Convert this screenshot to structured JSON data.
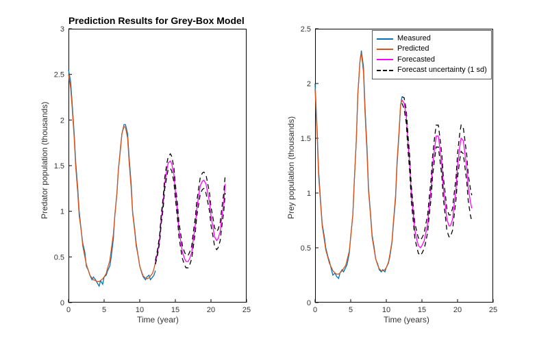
{
  "title": "Prediction Results for Grey-Box Model",
  "legend": {
    "items": [
      {
        "label": "Measured",
        "color": "#0072BD",
        "dash": "solid"
      },
      {
        "label": "Predicted",
        "color": "#D95319",
        "dash": "solid"
      },
      {
        "label": "Forecasted",
        "color": "#FF00FF",
        "dash": "solid"
      },
      {
        "label": "Forecast uncertainty (1 sd)",
        "color": "#000000",
        "dash": "dashed"
      }
    ]
  },
  "chart_data": [
    {
      "type": "line",
      "title": "",
      "xlabel": "Time (year)",
      "ylabel": "Predator population (thousands)",
      "xlim": [
        0,
        25
      ],
      "ylim": [
        0,
        3
      ],
      "xticks": [
        0,
        5,
        10,
        15,
        20,
        25
      ],
      "yticks": [
        0,
        0.5,
        1,
        1.5,
        2,
        2.5,
        3
      ],
      "series": [
        {
          "name": "Measured",
          "color": "#0072BD",
          "dash": "solid",
          "x": [
            0,
            0.3,
            0.5,
            0.8,
            1,
            1.3,
            1.5,
            1.8,
            2,
            2.3,
            2.5,
            2.8,
            3,
            3.3,
            3.5,
            3.8,
            4,
            4.3,
            4.5,
            4.8,
            5,
            5.3,
            5.5,
            5.8,
            6,
            6.3,
            6.5,
            6.8,
            7,
            7.3,
            7.5,
            7.8,
            8,
            8.3,
            8.5,
            8.8,
            9,
            9.3,
            9.5,
            9.8,
            10,
            10.3,
            10.5,
            10.8,
            11,
            11.3,
            11.5,
            11.8,
            12,
            12.2
          ],
          "values": [
            2.55,
            2.42,
            2.2,
            1.85,
            1.55,
            1.25,
            1.0,
            0.78,
            0.65,
            0.55,
            0.4,
            0.35,
            0.3,
            0.25,
            0.28,
            0.25,
            0.22,
            0.18,
            0.24,
            0.2,
            0.28,
            0.3,
            0.35,
            0.4,
            0.5,
            0.7,
            0.95,
            1.2,
            1.45,
            1.7,
            1.85,
            1.95,
            1.95,
            1.85,
            1.6,
            1.3,
            1.0,
            0.8,
            0.65,
            0.5,
            0.4,
            0.32,
            0.28,
            0.25,
            0.28,
            0.3,
            0.25,
            0.28,
            0.3,
            0.35
          ]
        },
        {
          "name": "Predicted",
          "color": "#D95319",
          "dash": "solid",
          "x": [
            0,
            0.3,
            0.5,
            0.8,
            1,
            1.3,
            1.5,
            1.8,
            2,
            2.3,
            2.5,
            2.8,
            3,
            3.3,
            3.5,
            3.8,
            4,
            4.3,
            4.5,
            4.8,
            5,
            5.3,
            5.5,
            5.8,
            6,
            6.3,
            6.5,
            6.8,
            7,
            7.3,
            7.5,
            7.8,
            8,
            8.3,
            8.5,
            8.8,
            9,
            9.3,
            9.5,
            9.8,
            10,
            10.3,
            10.5,
            10.8,
            11,
            11.3,
            11.5,
            11.8,
            12,
            12.2
          ],
          "values": [
            2.5,
            2.35,
            2.15,
            1.8,
            1.5,
            1.2,
            0.95,
            0.78,
            0.62,
            0.5,
            0.42,
            0.35,
            0.3,
            0.27,
            0.25,
            0.24,
            0.23,
            0.23,
            0.24,
            0.26,
            0.28,
            0.32,
            0.38,
            0.46,
            0.58,
            0.75,
            0.95,
            1.2,
            1.45,
            1.68,
            1.85,
            1.93,
            1.92,
            1.8,
            1.55,
            1.25,
            0.98,
            0.78,
            0.62,
            0.5,
            0.4,
            0.33,
            0.29,
            0.27,
            0.26,
            0.27,
            0.29,
            0.32,
            0.37,
            0.44
          ]
        },
        {
          "name": "Forecasted",
          "color": "#FF00FF",
          "dash": "solid",
          "x": [
            12.2,
            12.5,
            12.8,
            13,
            13.3,
            13.5,
            13.8,
            14,
            14.3,
            14.5,
            14.8,
            15,
            15.3,
            15.5,
            15.8,
            16,
            16.3,
            16.5,
            16.8,
            17,
            17.3,
            17.5,
            17.8,
            18,
            18.3,
            18.5,
            18.8,
            19,
            19.3,
            19.5,
            19.8,
            20,
            20.3,
            20.5,
            20.8,
            21,
            21.3,
            21.5,
            21.8,
            22
          ],
          "values": [
            0.44,
            0.55,
            0.7,
            0.9,
            1.1,
            1.3,
            1.45,
            1.53,
            1.55,
            1.52,
            1.4,
            1.22,
            1.0,
            0.8,
            0.65,
            0.55,
            0.48,
            0.45,
            0.45,
            0.48,
            0.55,
            0.68,
            0.85,
            1.02,
            1.18,
            1.28,
            1.33,
            1.34,
            1.3,
            1.22,
            1.1,
            0.95,
            0.82,
            0.72,
            0.68,
            0.7,
            0.78,
            0.92,
            1.1,
            1.3
          ]
        },
        {
          "name": "Forecast uncertainty upper",
          "color": "#000000",
          "dash": "dashed",
          "x": [
            12.2,
            12.5,
            12.8,
            13,
            13.3,
            13.5,
            13.8,
            14,
            14.3,
            14.5,
            14.8,
            15,
            15.3,
            15.5,
            15.8,
            16,
            16.3,
            16.5,
            16.8,
            17,
            17.3,
            17.5,
            17.8,
            18,
            18.3,
            18.5,
            18.8,
            19,
            19.3,
            19.5,
            19.8,
            20,
            20.3,
            20.5,
            20.8,
            21,
            21.3,
            21.5,
            21.8,
            22
          ],
          "values": [
            0.46,
            0.58,
            0.74,
            0.95,
            1.16,
            1.36,
            1.52,
            1.6,
            1.63,
            1.6,
            1.48,
            1.3,
            1.08,
            0.88,
            0.73,
            0.62,
            0.55,
            0.52,
            0.52,
            0.55,
            0.62,
            0.76,
            0.93,
            1.1,
            1.27,
            1.37,
            1.42,
            1.43,
            1.4,
            1.32,
            1.2,
            1.05,
            0.92,
            0.82,
            0.78,
            0.8,
            0.88,
            1.02,
            1.2,
            1.4
          ]
        },
        {
          "name": "Forecast uncertainty lower",
          "color": "#000000",
          "dash": "dashed",
          "x": [
            12.2,
            12.5,
            12.8,
            13,
            13.3,
            13.5,
            13.8,
            14,
            14.3,
            14.5,
            14.8,
            15,
            15.3,
            15.5,
            15.8,
            16,
            16.3,
            16.5,
            16.8,
            17,
            17.3,
            17.5,
            17.8,
            18,
            18.3,
            18.5,
            18.8,
            19,
            19.3,
            19.5,
            19.8,
            20,
            20.3,
            20.5,
            20.8,
            21,
            21.3,
            21.5,
            21.8,
            22
          ],
          "values": [
            0.42,
            0.52,
            0.66,
            0.85,
            1.04,
            1.24,
            1.38,
            1.46,
            1.47,
            1.44,
            1.32,
            1.14,
            0.92,
            0.72,
            0.57,
            0.48,
            0.41,
            0.38,
            0.38,
            0.41,
            0.48,
            0.6,
            0.77,
            0.94,
            1.09,
            1.19,
            1.24,
            1.25,
            1.2,
            1.12,
            1.0,
            0.85,
            0.72,
            0.62,
            0.58,
            0.6,
            0.68,
            0.82,
            1.0,
            1.2
          ]
        }
      ]
    },
    {
      "type": "line",
      "title": "",
      "xlabel": "Time (years)",
      "ylabel": "Prey population (thousands)",
      "xlim": [
        0,
        25
      ],
      "ylim": [
        0,
        2.5
      ],
      "xticks": [
        0,
        5,
        10,
        15,
        20,
        25
      ],
      "yticks": [
        0,
        0.5,
        1,
        1.5,
        2,
        2.5
      ],
      "series": [
        {
          "name": "Measured",
          "color": "#0072BD",
          "dash": "solid",
          "x": [
            0,
            0.3,
            0.5,
            0.8,
            1,
            1.3,
            1.5,
            1.8,
            2,
            2.3,
            2.5,
            2.8,
            3,
            3.3,
            3.5,
            3.8,
            4,
            4.3,
            4.5,
            4.8,
            5,
            5.3,
            5.5,
            5.8,
            6,
            6.3,
            6.5,
            6.8,
            7,
            7.3,
            7.5,
            7.8,
            8,
            8.3,
            8.5,
            8.8,
            9,
            9.3,
            9.5,
            9.8,
            10,
            10.3,
            10.5,
            10.8,
            11,
            11.3,
            11.5,
            11.8,
            12,
            12.2
          ],
          "values": [
            2.0,
            1.55,
            1.2,
            0.9,
            0.72,
            0.6,
            0.5,
            0.42,
            0.38,
            0.3,
            0.25,
            0.27,
            0.24,
            0.22,
            0.27,
            0.3,
            0.28,
            0.32,
            0.35,
            0.45,
            0.6,
            0.8,
            1.1,
            1.5,
            1.9,
            2.2,
            2.3,
            2.15,
            1.8,
            1.4,
            1.05,
            0.8,
            0.62,
            0.5,
            0.4,
            0.35,
            0.3,
            0.28,
            0.3,
            0.28,
            0.32,
            0.36,
            0.42,
            0.55,
            0.72,
            0.95,
            1.25,
            1.55,
            1.8,
            1.88
          ]
        },
        {
          "name": "Predicted",
          "color": "#D95319",
          "dash": "solid",
          "x": [
            0,
            0.3,
            0.5,
            0.8,
            1,
            1.3,
            1.5,
            1.8,
            2,
            2.3,
            2.5,
            2.8,
            3,
            3.3,
            3.5,
            3.8,
            4,
            4.3,
            4.5,
            4.8,
            5,
            5.3,
            5.5,
            5.8,
            6,
            6.3,
            6.5,
            6.8,
            7,
            7.3,
            7.5,
            7.8,
            8,
            8.3,
            8.5,
            8.8,
            9,
            9.3,
            9.5,
            9.8,
            10,
            10.3,
            10.5,
            10.8,
            11,
            11.3,
            11.5,
            11.8,
            12,
            12.2
          ],
          "values": [
            1.95,
            1.5,
            1.15,
            0.88,
            0.7,
            0.57,
            0.48,
            0.41,
            0.36,
            0.32,
            0.29,
            0.27,
            0.26,
            0.26,
            0.27,
            0.29,
            0.31,
            0.34,
            0.39,
            0.47,
            0.6,
            0.8,
            1.1,
            1.5,
            1.9,
            2.2,
            2.28,
            2.1,
            1.75,
            1.35,
            1.02,
            0.78,
            0.6,
            0.48,
            0.4,
            0.34,
            0.31,
            0.29,
            0.29,
            0.3,
            0.32,
            0.37,
            0.44,
            0.56,
            0.74,
            0.98,
            1.28,
            1.58,
            1.8,
            1.85
          ]
        },
        {
          "name": "Forecasted",
          "color": "#FF00FF",
          "dash": "solid",
          "x": [
            12.2,
            12.5,
            12.8,
            13,
            13.3,
            13.5,
            13.8,
            14,
            14.3,
            14.5,
            14.8,
            15,
            15.3,
            15.5,
            15.8,
            16,
            16.3,
            16.5,
            16.8,
            17,
            17.3,
            17.5,
            17.8,
            18,
            18.3,
            18.5,
            18.8,
            19,
            19.3,
            19.5,
            19.8,
            20,
            20.3,
            20.5,
            20.8,
            21,
            21.3,
            21.5,
            21.8,
            22
          ],
          "values": [
            1.85,
            1.82,
            1.7,
            1.5,
            1.25,
            1.0,
            0.8,
            0.66,
            0.57,
            0.52,
            0.5,
            0.52,
            0.56,
            0.62,
            0.72,
            0.86,
            1.05,
            1.25,
            1.42,
            1.52,
            1.52,
            1.42,
            1.25,
            1.05,
            0.88,
            0.76,
            0.7,
            0.7,
            0.76,
            0.88,
            1.05,
            1.25,
            1.42,
            1.5,
            1.48,
            1.38,
            1.22,
            1.05,
            0.92,
            0.86
          ]
        },
        {
          "name": "Forecast uncertainty upper",
          "color": "#000000",
          "dash": "dashed",
          "x": [
            12.2,
            12.5,
            12.8,
            13,
            13.3,
            13.5,
            13.8,
            14,
            14.3,
            14.5,
            14.8,
            15,
            15.3,
            15.5,
            15.8,
            16,
            16.3,
            16.5,
            16.8,
            17,
            17.3,
            17.5,
            17.8,
            18,
            18.3,
            18.5,
            18.8,
            19,
            19.3,
            19.5,
            19.8,
            20,
            20.3,
            20.5,
            20.8,
            21,
            21.3,
            21.5,
            21.8,
            22
          ],
          "values": [
            1.88,
            1.87,
            1.76,
            1.57,
            1.32,
            1.07,
            0.87,
            0.73,
            0.64,
            0.59,
            0.57,
            0.59,
            0.63,
            0.7,
            0.8,
            0.94,
            1.14,
            1.34,
            1.52,
            1.62,
            1.62,
            1.52,
            1.35,
            1.15,
            0.98,
            0.86,
            0.8,
            0.8,
            0.86,
            0.98,
            1.15,
            1.36,
            1.54,
            1.62,
            1.6,
            1.5,
            1.34,
            1.17,
            1.04,
            0.98
          ]
        },
        {
          "name": "Forecast uncertainty lower",
          "color": "#000000",
          "dash": "dashed",
          "x": [
            12.2,
            12.5,
            12.8,
            13,
            13.3,
            13.5,
            13.8,
            14,
            14.3,
            14.5,
            14.8,
            15,
            15.3,
            15.5,
            15.8,
            16,
            16.3,
            16.5,
            16.8,
            17,
            17.3,
            17.5,
            17.8,
            18,
            18.3,
            18.5,
            18.8,
            19,
            19.3,
            19.5,
            19.8,
            20,
            20.3,
            20.5,
            20.8,
            21,
            21.3,
            21.5,
            21.8,
            22
          ],
          "values": [
            1.82,
            1.77,
            1.64,
            1.43,
            1.18,
            0.93,
            0.73,
            0.59,
            0.5,
            0.45,
            0.43,
            0.45,
            0.49,
            0.54,
            0.64,
            0.78,
            0.96,
            1.16,
            1.32,
            1.42,
            1.42,
            1.32,
            1.15,
            0.95,
            0.78,
            0.66,
            0.6,
            0.6,
            0.66,
            0.78,
            0.95,
            1.14,
            1.3,
            1.38,
            1.36,
            1.26,
            1.1,
            0.93,
            0.8,
            0.74
          ]
        }
      ]
    }
  ]
}
